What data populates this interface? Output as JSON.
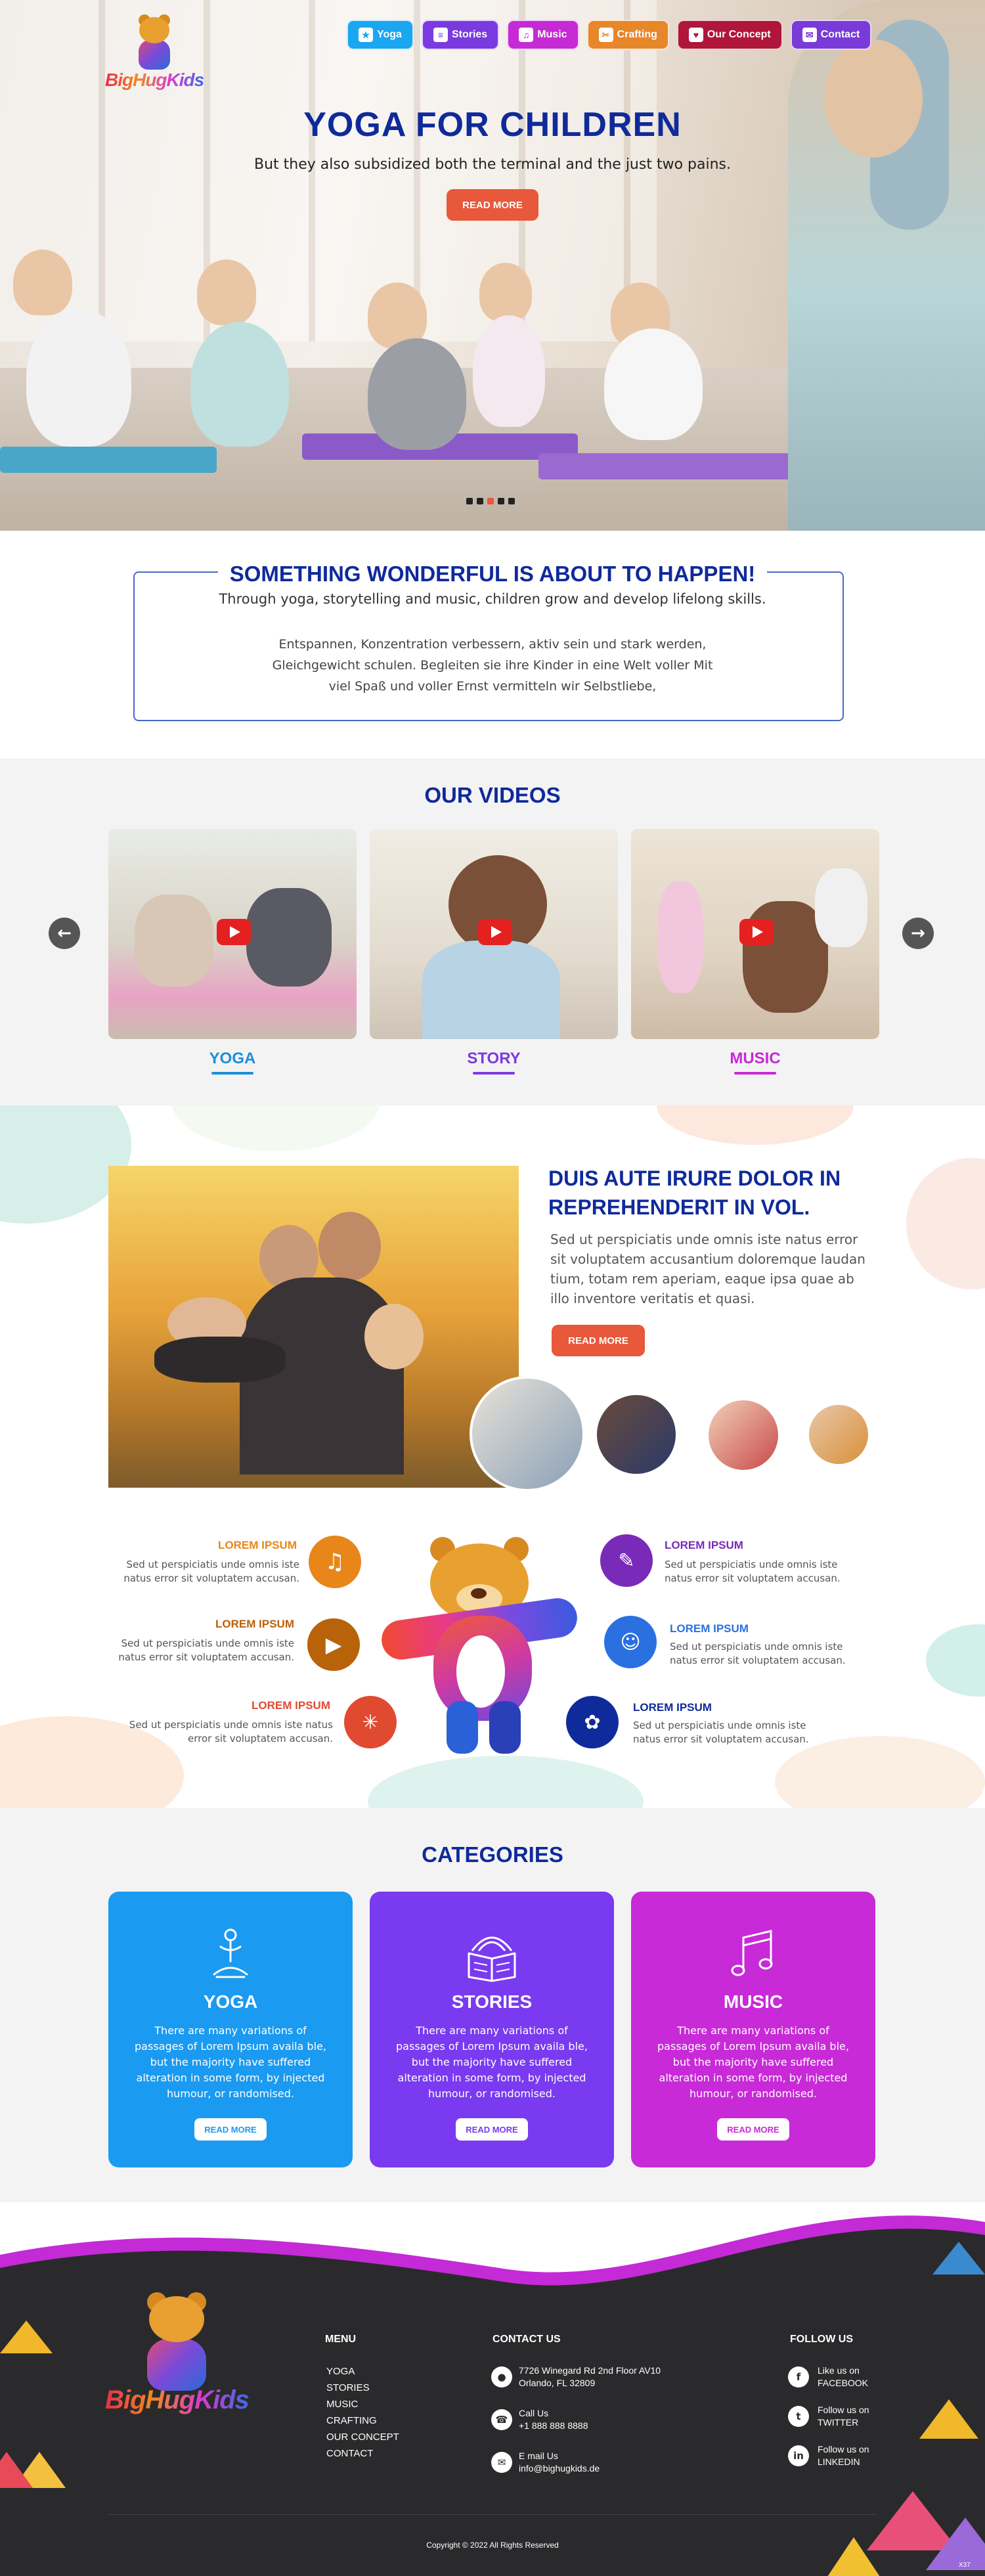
{
  "brand": {
    "logo_text": "BigHugKids"
  },
  "nav": [
    {
      "label": "Yoga",
      "icon": "yoga-icon",
      "color": "#1aa6f0"
    },
    {
      "label": "Stories",
      "icon": "book-icon",
      "color": "#7a3ae0"
    },
    {
      "label": "Music",
      "icon": "music-note-icon",
      "color": "#c62ad4"
    },
    {
      "label": "Crafting",
      "icon": "scissors-icon",
      "color": "#e8862a"
    },
    {
      "label": "Our Concept",
      "icon": "heart-icon",
      "color": "#b0153a"
    },
    {
      "label": "Contact",
      "icon": "envelope-icon",
      "color": "#7a3ad8"
    }
  ],
  "hero": {
    "title": "YOGA FOR CHILDREN",
    "subtitle": "But they also subsidized both the terminal and the just two pains.",
    "button": "READ MORE",
    "slides": 5,
    "active_slide": 3
  },
  "wonderful": {
    "title": "SOMETHING WONDERFUL IS ABOUT TO HAPPEN!",
    "subtitle": "Through yoga, storytelling and music, children grow and develop lifelong skills.",
    "text": "Entspannen, Konzentration verbessern, aktiv sein und stark werden, Gleichgewicht schulen. Begleiten sie ihre Kinder in eine Welt voller Mit viel Spaß und voller Ernst vermitteln wir Selbstliebe,"
  },
  "videos": {
    "title": "OUR VIDEOS",
    "items": [
      {
        "label": "YOGA",
        "color": "#1a8fd8"
      },
      {
        "label": "STORY",
        "color": "#7a3ae0"
      },
      {
        "label": "MUSIC",
        "color": "#c62ad4"
      }
    ]
  },
  "family": {
    "title": "DUIS AUTE IRURE DOLOR IN REPREHENDERIT IN VOL.",
    "text": "Sed ut perspiciatis unde omnis iste natus error sit voluptatem accusantium doloremque laudan tium, totam rem aperiam, eaque ipsa quae ab illo inventore veritatis et quasi.",
    "button": "READ MORE"
  },
  "features": [
    {
      "title": "LOREM IPSUM",
      "text": "Sed ut perspiciatis unde omnis iste natus error sit voluptatem accusan.",
      "color": "#e8861a",
      "icon": "music-list-icon"
    },
    {
      "title": "LOREM IPSUM",
      "text": "Sed ut perspiciatis unde omnis iste natus error sit voluptatem accusan.",
      "color": "#b8620a",
      "icon": "play-icon"
    },
    {
      "title": "LOREM IPSUM",
      "text": "Sed ut perspiciatis unde omnis iste natus error sit voluptatem accusan.",
      "color": "#e04a30",
      "icon": "burst-icon"
    },
    {
      "title": "LOREM IPSUM",
      "text": "Sed ut perspiciatis unde omnis iste natus error sit voluptatem accusan.",
      "color": "#7a2ab8",
      "icon": "edit-icon"
    },
    {
      "title": "LOREM IPSUM",
      "text": "Sed ut perspiciatis unde omnis iste natus error sit voluptatem accusan.",
      "color": "#2a70e0",
      "icon": "meditation-icon"
    },
    {
      "title": "LOREM IPSUM",
      "text": "Sed ut perspiciatis unde omnis iste natus error sit voluptatem accusan.",
      "color": "#0f2a9a",
      "icon": "lotus-icon"
    }
  ],
  "categories": {
    "title": "CATEGORIES",
    "items": [
      {
        "title": "YOGA",
        "text": "There are many variations of passages of Lorem Ipsum availa ble, but the majority have suffered alteration in some form, by injected humour, or randomised.",
        "button": "READ MORE",
        "color": "#1a9af0",
        "icon": "yoga-icon"
      },
      {
        "title": "STORIES",
        "text": "There are many variations of passages of Lorem Ipsum availa ble, but the majority have suffered alteration in some form, by injected humour, or randomised.",
        "button": "READ MORE",
        "color": "#7a3af0",
        "icon": "book-icon"
      },
      {
        "title": "MUSIC",
        "text": "There are many variations of passages of Lorem Ipsum availa ble, but the majority have suffered alteration in some form, by injected humour, or randomised.",
        "button": "READ MORE",
        "color": "#c82ad8",
        "icon": "music-note-icon"
      }
    ]
  },
  "footer": {
    "menu_title": "MENU",
    "menu": [
      "YOGA",
      "STORIES",
      "MUSIC",
      "CRAFTING",
      "OUR CONCEPT",
      "CONTACT"
    ],
    "contact_title": "CONTACT US",
    "address_1": "7726 Winegard Rd 2nd Floor AV10",
    "address_2": "Orlando, FL 32809",
    "call_label": "Call Us",
    "phone": "+1 888 888 8888",
    "email_label": "E mail Us",
    "email": "info@bighugkids.de",
    "follow_title": "FOLLOW US",
    "social": [
      {
        "label": "Like us on",
        "network": "FACEBOOK",
        "icon": "facebook-icon"
      },
      {
        "label": "Follow us on",
        "network": "TWITTER",
        "icon": "twitter-icon"
      },
      {
        "label": "Follow us on",
        "network": "LINKEDIN",
        "icon": "linkedin-icon"
      }
    ],
    "copyright": "Copyright © 2022 All Rights Reserved",
    "corner_mark": "X37"
  }
}
